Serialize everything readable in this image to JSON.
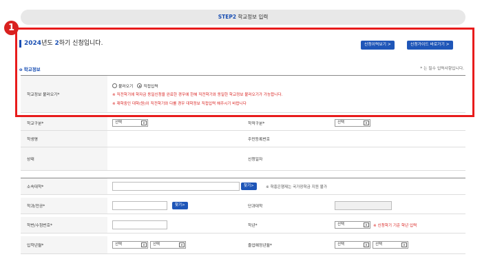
{
  "step": {
    "prefix": "STEP2",
    "label": "학교정보 입력"
  },
  "badge": "1",
  "title": {
    "year": "2024",
    "mid1": "년도 ",
    "term": "2",
    "mid2": "하기 신청입니다."
  },
  "buttons": {
    "view_history": "신청이력보기 >",
    "guide": "신청가이드 바로가기 >"
  },
  "section_title": "o 학교정보",
  "required_note": "* 는 필수 입력사항입니다.",
  "load": {
    "label": "학교정보 불러오기*",
    "option1": "불러오기",
    "option2": "직접입력",
    "note1": "※ 직전학기에 학자금 동일신청을 완료한 경우에 한해 직전학기와 동일한 학교정보 불러오기가 가능합니다.",
    "note2": "※ 재학중인 대학(원)이 직전학기와 다를 경우 대학정보 직접입력 해주시기 바랍니다"
  },
  "rows": {
    "school_type": "학교구분*",
    "enroll_type": "학적구분*",
    "student_name": "학생명",
    "resident_no": "주민등록번호",
    "status": "상태",
    "apply_date": "신청일자",
    "university": "소속대학*",
    "major": "학과/전공*",
    "college": "단과대학",
    "student_id": "학번/수험번호*",
    "grade": "학년*",
    "admission": "입학년월*",
    "graduation": "졸업예정년월*"
  },
  "select_default": "선택",
  "search_btn": "찾기>",
  "univ_note": "※ 학흥은행제는 국가장학금 지원 불가",
  "grade_note": "※ 신청학기 기준 학년 입력"
}
